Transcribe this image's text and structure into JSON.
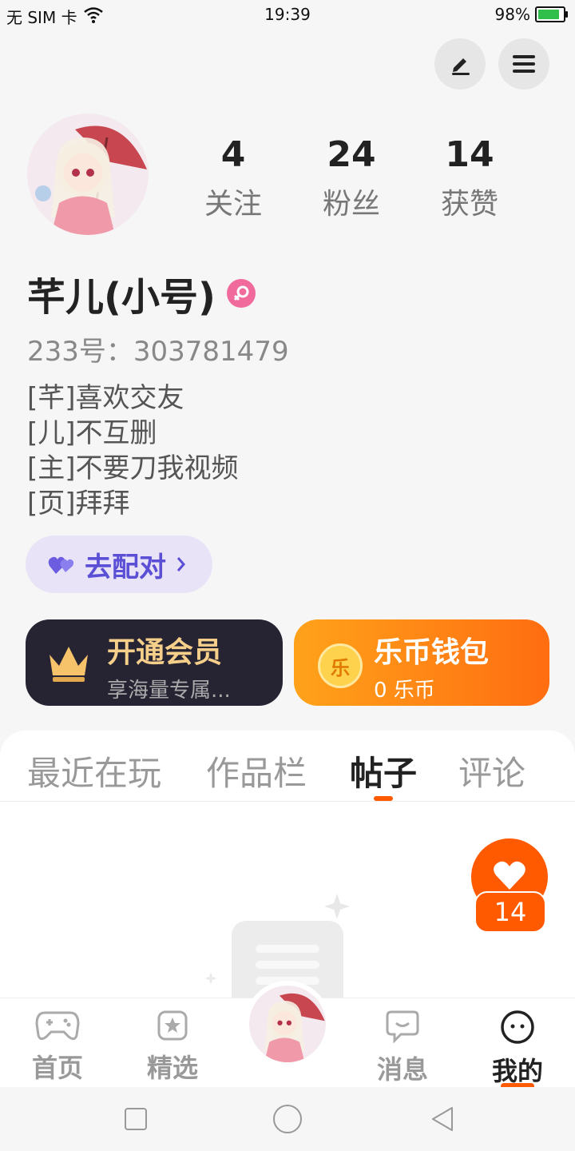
{
  "status_bar": {
    "carrier": "无 SIM 卡",
    "time": "19:39",
    "battery": "98%"
  },
  "profile": {
    "stats": [
      {
        "num": "4",
        "label": "关注"
      },
      {
        "num": "24",
        "label": "粉丝"
      },
      {
        "num": "14",
        "label": "获赞"
      }
    ],
    "name": "芊儿(小号)",
    "uid": "233号：303781479",
    "bio": [
      "[芊]喜欢交友",
      "[儿]不互删",
      "[主]不要刀我视频",
      "[页]拜拜"
    ],
    "pair_button": "去配对"
  },
  "cards": {
    "vip": {
      "title": "开通会员",
      "sub": "享海量专属..."
    },
    "wallet": {
      "title": "乐币钱包",
      "sub": "0 乐币",
      "coin_char": "乐"
    }
  },
  "tabs": [
    "最近在玩",
    "作品栏",
    "帖子",
    "评论"
  ],
  "active_tab": 2,
  "like_fab": {
    "count": "14"
  },
  "nav": [
    {
      "label": "首页"
    },
    {
      "label": "精选"
    },
    {
      "label": "消息"
    },
    {
      "label": "我的"
    }
  ],
  "colors": {
    "accent": "#ff5a00",
    "pair": "#5b4fd6",
    "gender": "#f06b9b",
    "vip_bg": "#262333"
  }
}
